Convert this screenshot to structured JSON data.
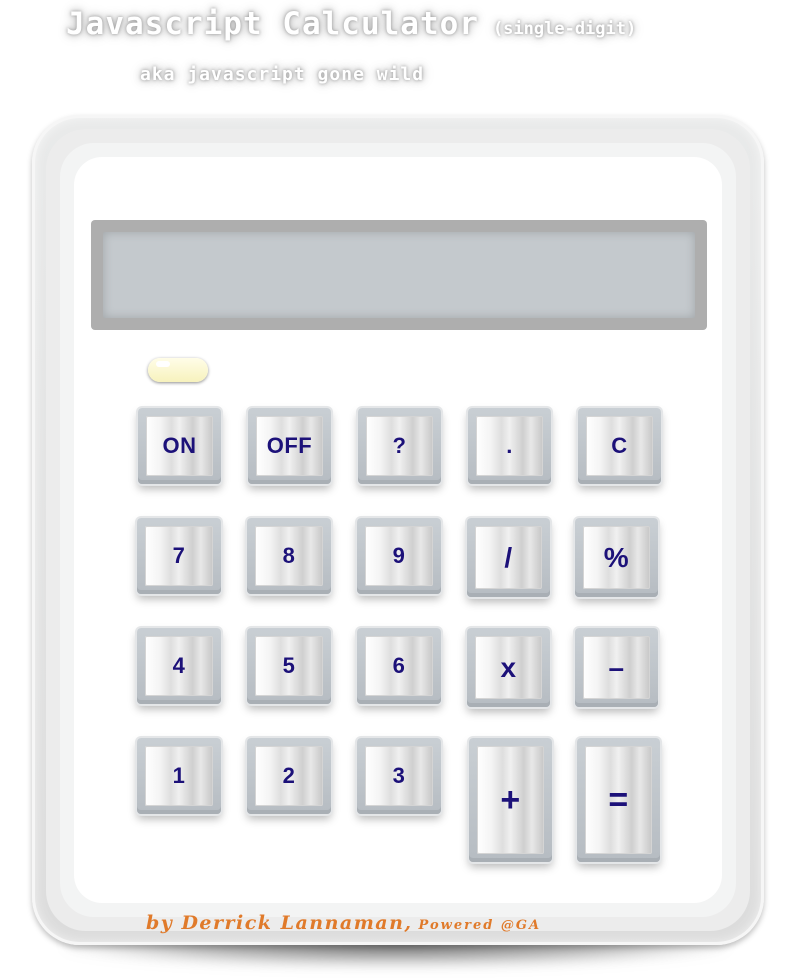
{
  "header": {
    "title": "Javascript Calculator",
    "title_suffix": "(single-digit)",
    "tagline": "aka javascript gone wild"
  },
  "display": {
    "value": ""
  },
  "keys": {
    "row1": [
      "ON",
      "OFF",
      "?",
      ".",
      "C"
    ],
    "row2": [
      "7",
      "8",
      "9",
      "/",
      "%"
    ],
    "row3": [
      "4",
      "5",
      "6",
      "x",
      "–"
    ],
    "row4": [
      "1",
      "2",
      "3",
      "+",
      "="
    ]
  },
  "footer": {
    "credit": "by Derrick Lannaman,",
    "powered": "Powered @GA"
  },
  "colors": {
    "key_text": "#1c1179",
    "credit_text": "#e07a2a",
    "display_bg": "#c4c9cd",
    "solar_panel": "#f7f2bd"
  },
  "icons": {
    "solar_indicator": "solar-panel-icon"
  }
}
